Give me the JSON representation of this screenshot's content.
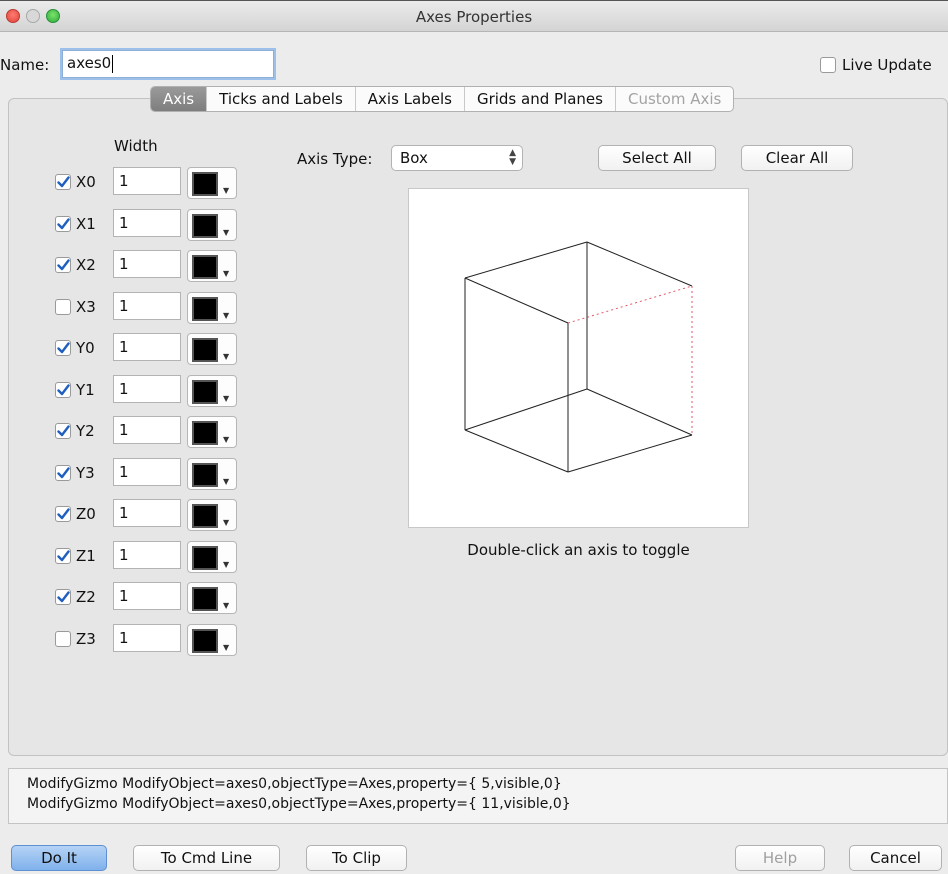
{
  "window": {
    "title": "Axes Properties"
  },
  "name_field": {
    "label": "Name:",
    "value": "axes0"
  },
  "live_update": {
    "label": "Live Update",
    "checked": false
  },
  "tabs": [
    {
      "label": "Axis",
      "active": true,
      "enabled": true
    },
    {
      "label": "Ticks and Labels",
      "active": false,
      "enabled": true
    },
    {
      "label": "Axis Labels",
      "active": false,
      "enabled": true
    },
    {
      "label": "Grids and Planes",
      "active": false,
      "enabled": true
    },
    {
      "label": "Custom Axis",
      "active": false,
      "enabled": false
    }
  ],
  "axis_panel": {
    "width_header": "Width",
    "axes": [
      {
        "name": "X0",
        "checked": true,
        "width": "1",
        "color": "#000000"
      },
      {
        "name": "X1",
        "checked": true,
        "width": "1",
        "color": "#000000"
      },
      {
        "name": "X2",
        "checked": true,
        "width": "1",
        "color": "#000000"
      },
      {
        "name": "X3",
        "checked": false,
        "width": "1",
        "color": "#000000"
      },
      {
        "name": "Y0",
        "checked": true,
        "width": "1",
        "color": "#000000"
      },
      {
        "name": "Y1",
        "checked": true,
        "width": "1",
        "color": "#000000"
      },
      {
        "name": "Y2",
        "checked": true,
        "width": "1",
        "color": "#000000"
      },
      {
        "name": "Y3",
        "checked": true,
        "width": "1",
        "color": "#000000"
      },
      {
        "name": "Z0",
        "checked": true,
        "width": "1",
        "color": "#000000"
      },
      {
        "name": "Z1",
        "checked": true,
        "width": "1",
        "color": "#000000"
      },
      {
        "name": "Z2",
        "checked": true,
        "width": "1",
        "color": "#000000"
      },
      {
        "name": "Z3",
        "checked": false,
        "width": "1",
        "color": "#000000"
      }
    ],
    "axis_type": {
      "label": "Axis Type:",
      "value": "Box"
    },
    "select_all": "Select All",
    "clear_all": "Clear All",
    "preview_hint": "Double-click an axis to toggle"
  },
  "command_lines": [
    "ModifyGizmo ModifyObject=axes0,objectType=Axes,property={ 5,visible,0}",
    "ModifyGizmo ModifyObject=axes0,objectType=Axes,property={ 11,visible,0}"
  ],
  "buttons": {
    "do_it": "Do It",
    "to_cmd_line": "To Cmd Line",
    "to_clip": "To Clip",
    "help": "Help",
    "cancel": "Cancel"
  },
  "colors": {
    "accent": "#7fb1ec",
    "close": "#e0433a",
    "hidden_axis": "#e05a6a"
  }
}
